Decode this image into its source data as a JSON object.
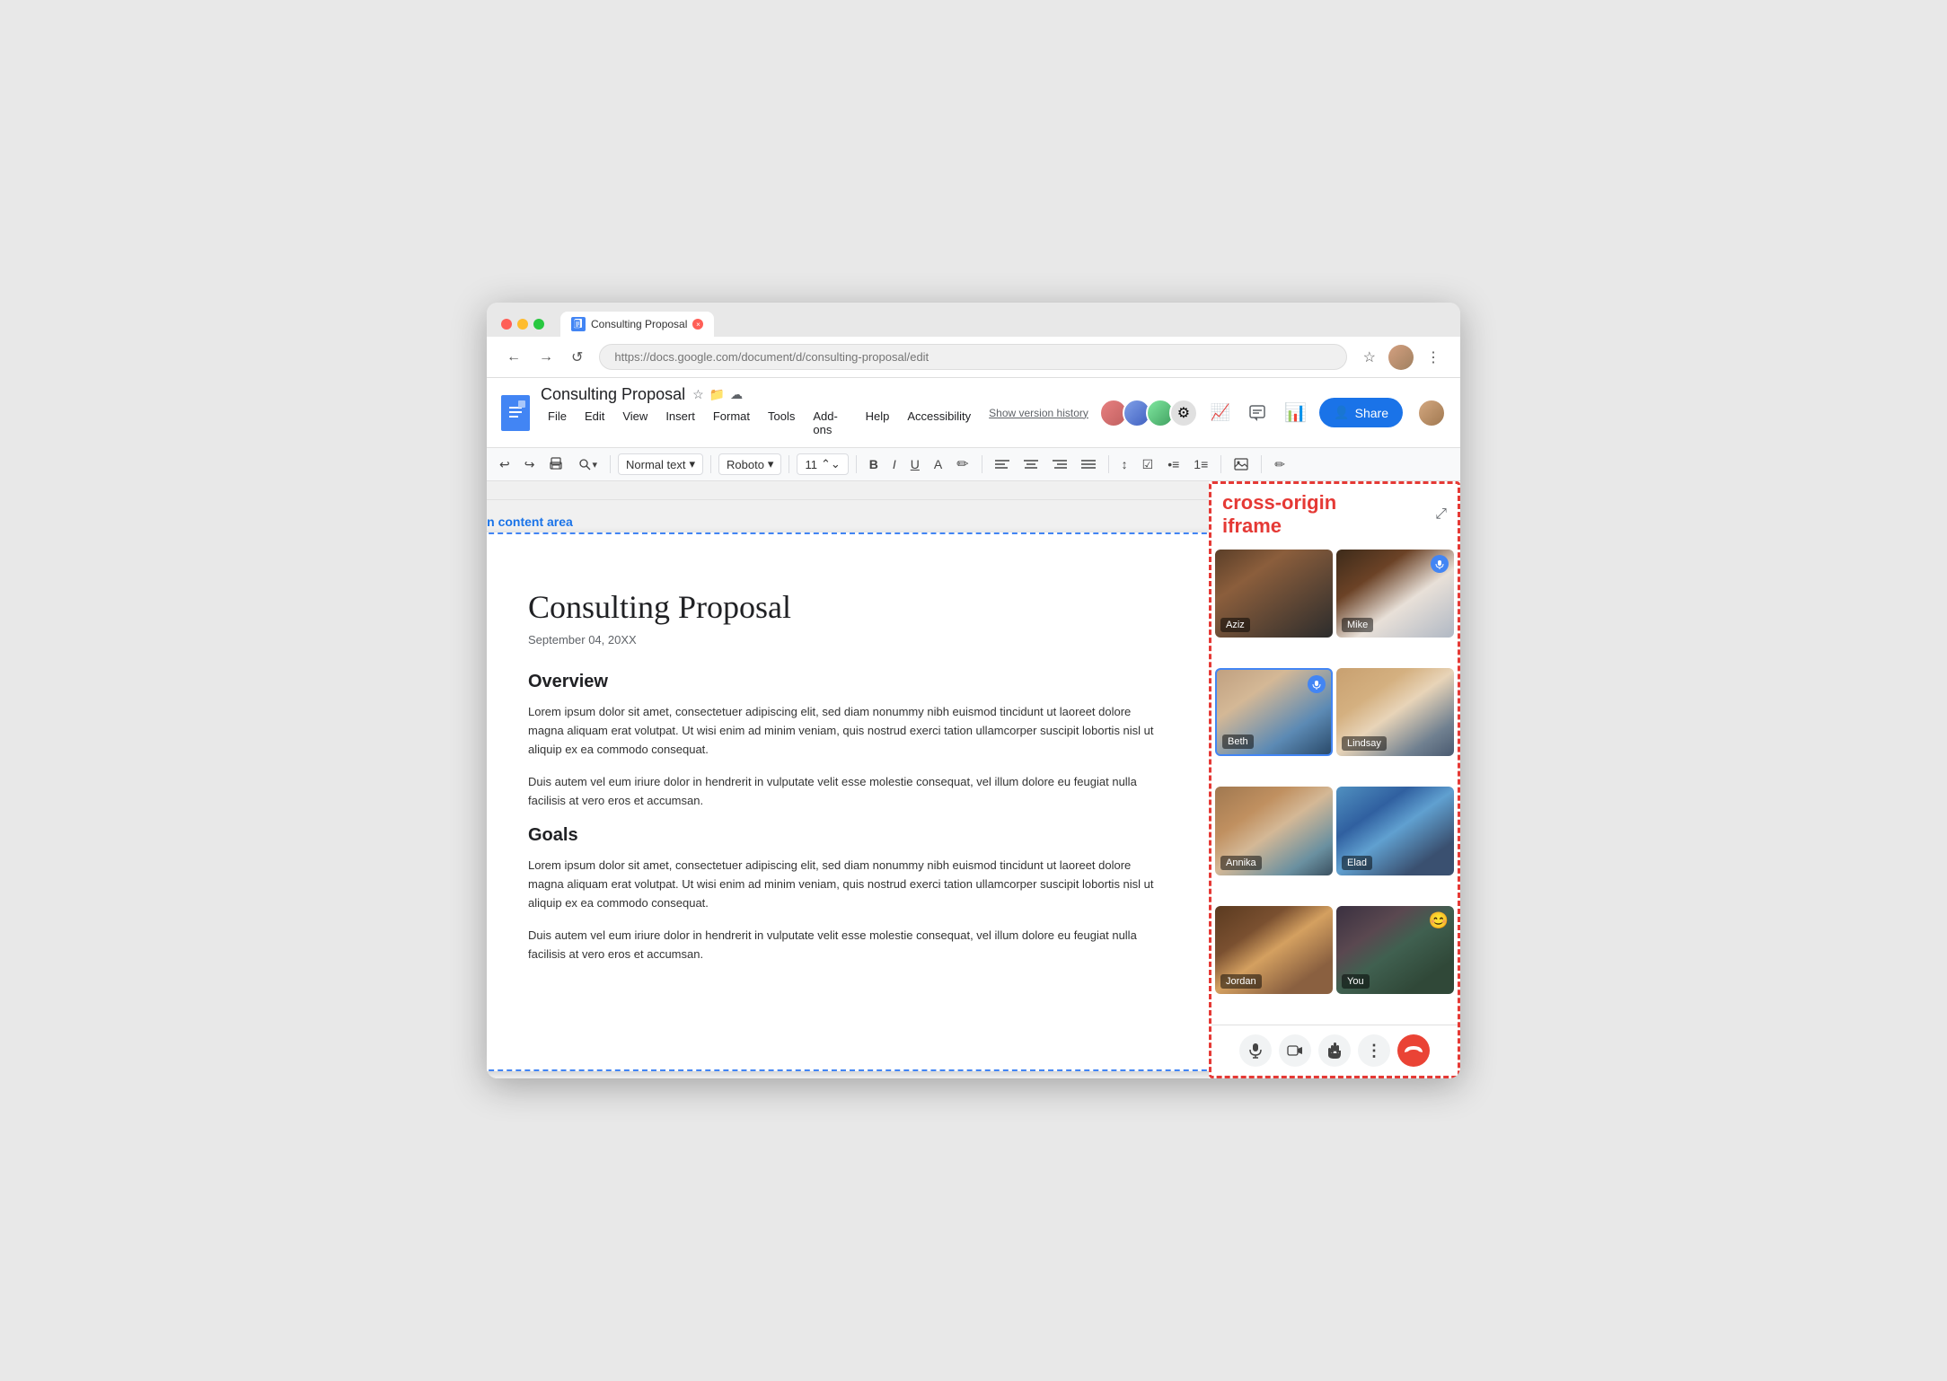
{
  "browser": {
    "tab_title": "Consulting Proposal",
    "tab_favicon": "📄",
    "back_btn": "←",
    "forward_btn": "→",
    "reload_btn": "↺",
    "star_icon": "☆",
    "menu_icon": "⋮"
  },
  "docs": {
    "logo_letter": "≡",
    "title": "Consulting Proposal",
    "star_icon": "☆",
    "folder_icon": "📁",
    "cloud_icon": "☁",
    "menu": {
      "file": "File",
      "edit": "Edit",
      "view": "View",
      "insert": "Insert",
      "format": "Format",
      "tools": "Tools",
      "addons": "Add-ons",
      "help": "Help",
      "accessibility": "Accessibility"
    },
    "version_history": "Show version history",
    "share_btn": "Share",
    "toolbar": {
      "undo": "↩",
      "redo": "↪",
      "print": "🖨",
      "zoom": "🔍",
      "normal_text": "Normal text",
      "font": "Roboto",
      "font_size": "11",
      "bold": "B",
      "italic": "I",
      "underline": "U",
      "text_color": "A",
      "highlight": "✏",
      "align_left": "≡",
      "align_center": "≡",
      "align_right": "≡",
      "align_justify": "≡",
      "line_spacing": "↕",
      "bullets": "•≡",
      "numbered": "1≡",
      "image": "🖼",
      "edit_tools": "✏"
    }
  },
  "document": {
    "main_content_label": "main content area",
    "title": "Consulting Proposal",
    "date": "September 04, 20XX",
    "section1_heading": "Overview",
    "section1_p1": "Lorem ipsum dolor sit amet, consectetuer adipiscing elit, sed diam nonummy nibh euismod tincidunt ut laoreet dolore magna aliquam erat volutpat. Ut wisi enim ad minim veniam, quis nostrud exerci tation ullamcorper suscipit lobortis nisl ut aliquip ex ea commodo consequat.",
    "section1_p2": "Duis autem vel eum iriure dolor in hendrerit in vulputate velit esse molestie consequat, vel illum dolore eu feugiat nulla facilisis at vero eros et accumsan.",
    "section2_heading": "Goals",
    "section2_p1": "Lorem ipsum dolor sit amet, consectetuer adipiscing elit, sed diam nonummy nibh euismod tincidunt ut laoreet dolore magna aliquam erat volutpat. Ut wisi enim ad minim veniam, quis nostrud exerci tation ullamcorper suscipit lobortis nisl ut aliquip ex ea commodo consequat.",
    "section2_p2": "Duis autem vel eum iriure dolor in hendrerit in vulputate velit esse molestie consequat, vel illum dolore eu feugiat nulla facilisis at vero eros et accumsan."
  },
  "iframe": {
    "title_line1": "cross-origin",
    "title_line2": "iframe",
    "expand_icon": "⤢",
    "participants": [
      {
        "id": "aziz",
        "name": "Aziz",
        "speaking": false,
        "active": false
      },
      {
        "id": "mike",
        "name": "Mike",
        "speaking": true,
        "active": false
      },
      {
        "id": "beth",
        "name": "Beth",
        "speaking": true,
        "active": true
      },
      {
        "id": "lindsay",
        "name": "Lindsay",
        "speaking": false,
        "active": false
      },
      {
        "id": "annika",
        "name": "Annika",
        "speaking": false,
        "active": false
      },
      {
        "id": "elad",
        "name": "Elad",
        "speaking": false,
        "active": false
      },
      {
        "id": "jordan",
        "name": "Jordan",
        "speaking": false,
        "active": false
      },
      {
        "id": "you",
        "name": "You",
        "speaking": false,
        "active": false,
        "emoji": "😊"
      }
    ],
    "controls": {
      "mic": "🎤",
      "camera": "📷",
      "hand": "✋",
      "more": "⋮",
      "end_call": "📞"
    }
  },
  "colors": {
    "blue": "#1a73e8",
    "red": "#e53935",
    "doc_border": "#4285f4"
  }
}
